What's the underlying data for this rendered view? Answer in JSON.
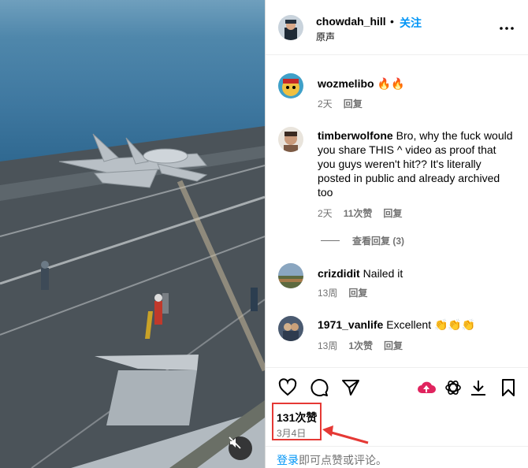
{
  "post": {
    "username": "chowdah_hill",
    "separator": "•",
    "follow_label": "关注",
    "audio_label": "原声"
  },
  "comments": [
    {
      "username": "wozmelibo",
      "text": "🔥🔥",
      "time": "2天",
      "reply": "回复"
    },
    {
      "username": "timberwolfone",
      "text": "Bro, why the fuck would you share THIS ^ video as proof that you guys weren't hit?? It's literally posted in public and already archived too",
      "time": "2天",
      "likes": "11次赞",
      "reply": "回复",
      "view_replies": "查看回复 (3)"
    },
    {
      "username": "crizdidit",
      "text": "Nailed it",
      "time": "13周",
      "reply": "回复"
    },
    {
      "username": "1971_vanlife",
      "text": "Excellent 👏👏👏",
      "time": "13周",
      "likes": "1次赞",
      "reply": "回复"
    }
  ],
  "stats": {
    "likes": "131次赞",
    "date": "3月4日"
  },
  "footer": {
    "login": "登录",
    "rest": "即可点赞或评论。"
  },
  "icons": {
    "more": "more-dots-icon",
    "like": "heart-icon",
    "comment": "comment-bubble-icon",
    "share": "paper-plane-icon",
    "cloud": "cloud-upload-icon",
    "chatgpt": "openai-knot-icon",
    "download": "download-icon",
    "save": "bookmark-icon",
    "mute": "speaker-muted-icon"
  },
  "colors": {
    "accent": "#0095f6",
    "annotation": "#e53935",
    "muted_text": "#737373"
  }
}
